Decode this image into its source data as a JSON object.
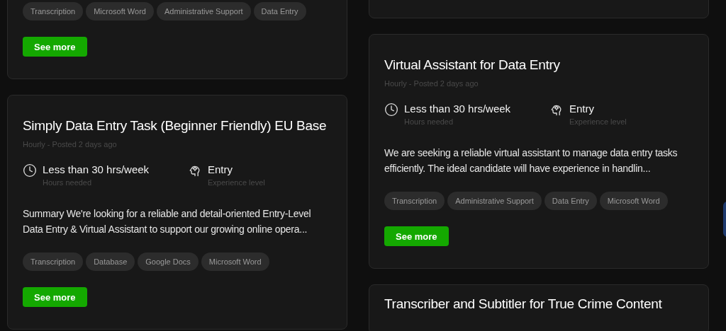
{
  "columns": [
    {
      "cards": [
        {
          "kind": "job",
          "tags": [
            "Transcription",
            "Microsoft Word",
            "Administrative Support",
            "Data Entry"
          ],
          "button": "See more"
        },
        {
          "kind": "job",
          "title": "Simply Data Entry Task (Beginner Friendly) EU Base",
          "meta": "Hourly - Posted 2 days ago",
          "hours": {
            "value": "Less than 30 hrs/week",
            "label": "Hours needed"
          },
          "level": {
            "value": "Entry",
            "label": "Experience level"
          },
          "description": "Summary We're looking for a reliable and detail-oriented Entry-Level Data Entry & Virtual Assistant to support our growing online opera...",
          "tags": [
            "Transcription",
            "Database",
            "Google Docs",
            "Microsoft Word"
          ],
          "button": "See more"
        }
      ]
    },
    {
      "cards": [
        {
          "kind": "job"
        },
        {
          "kind": "job",
          "title": "Virtual Assistant for Data Entry",
          "meta": "Hourly - Posted 2 days ago",
          "hours": {
            "value": "Less than 30 hrs/week",
            "label": "Hours needed"
          },
          "level": {
            "value": "Entry",
            "label": "Experience level"
          },
          "description": "We are seeking a reliable virtual assistant to manage data entry tasks efficiently. The ideal candidate will have experience in handlin...",
          "tags": [
            "Transcription",
            "Administrative Support",
            "Data Entry",
            "Microsoft Word"
          ],
          "button": "See more"
        },
        {
          "kind": "job",
          "title": "Transcriber and Subtitler for True Crime Content"
        }
      ]
    }
  ]
}
